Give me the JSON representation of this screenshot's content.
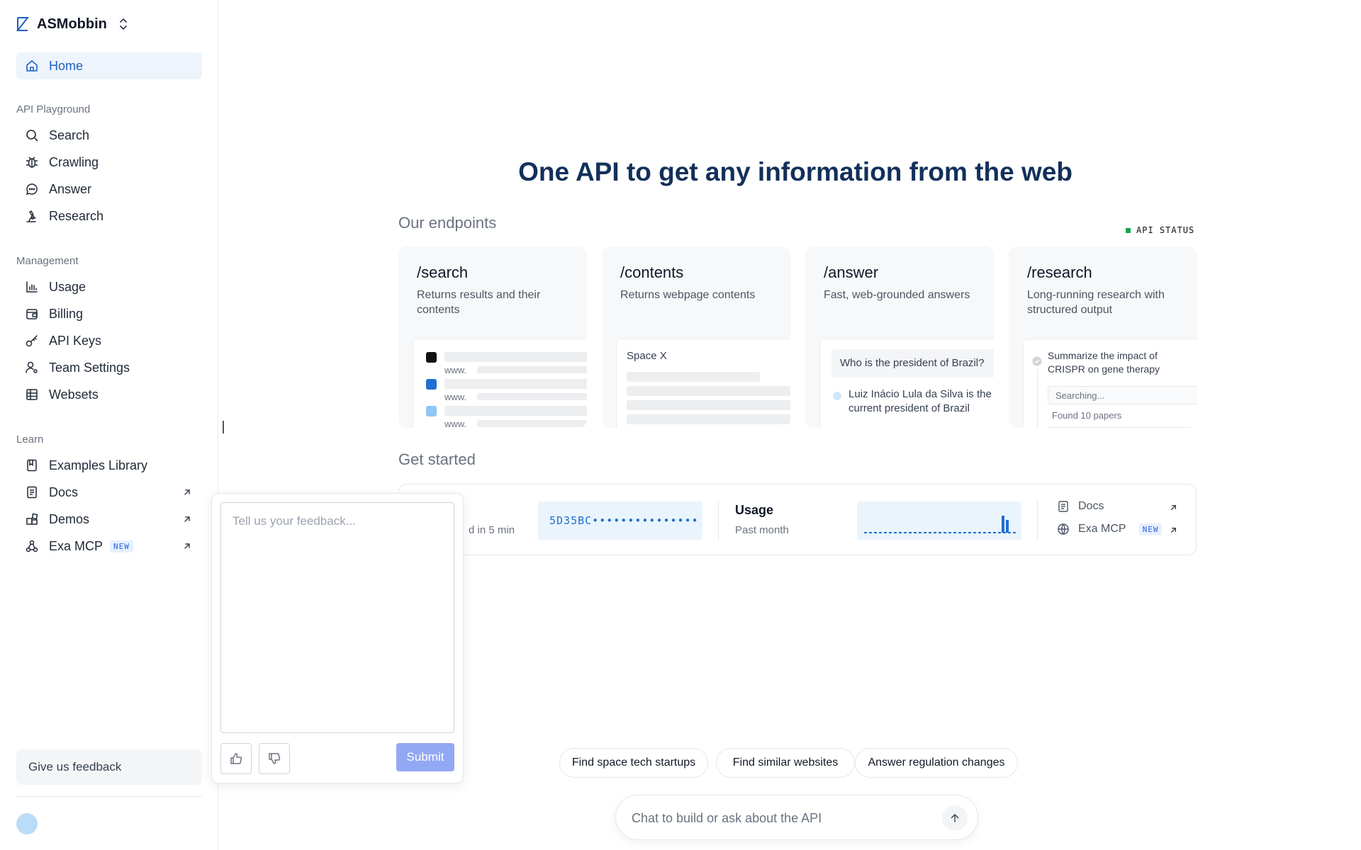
{
  "brand": {
    "name": "ASMobbin"
  },
  "sidebar": {
    "home": "Home",
    "sections": {
      "playground": "API Playground",
      "management": "Management",
      "learn": "Learn"
    },
    "playground_items": [
      "Search",
      "Crawling",
      "Answer",
      "Research"
    ],
    "management_items": [
      "Usage",
      "Billing",
      "API Keys",
      "Team Settings",
      "Websets"
    ],
    "learn_items": [
      "Examples Library",
      "Docs",
      "Demos",
      "Exa MCP"
    ],
    "new_badge": "NEW",
    "feedback_button": "Give us feedback"
  },
  "feedback": {
    "placeholder": "Tell us your feedback...",
    "submit": "Submit"
  },
  "main": {
    "hero": "One API to get any information from the web",
    "endpoints_heading": "Our endpoints",
    "api_status": "API STATUS",
    "cards": [
      {
        "title": "/search",
        "desc": "Returns results and their contents",
        "preview_label": "www."
      },
      {
        "title": "/contents",
        "desc": "Returns webpage contents",
        "preview_label": "Space X"
      },
      {
        "title": "/answer",
        "desc": "Fast, web-grounded answers",
        "question": "Who is the president of Brazil?",
        "reply": "Luiz Inácio Lula da Silva is the current president of Brazil"
      },
      {
        "title": "/research",
        "desc": "Long-running research with structured output",
        "task": "Summarize the impact of CRISPR on gene therapy",
        "status": "Searching...",
        "found": "Found 10 papers"
      }
    ],
    "get_started_heading": "Get started",
    "get_started": {
      "partial_text": "d in 5 min",
      "api_key": "5D35BC•••••••••••••••",
      "usage_title": "Usage",
      "usage_sub": "Past month",
      "docs_label": "Docs",
      "mcp_label": "Exa MCP",
      "new_badge": "NEW"
    },
    "chips": [
      "Find space tech startups",
      "Find similar websites",
      "Answer regulation changes"
    ],
    "chat_placeholder": "Chat to build or ask about the API"
  },
  "colors": {
    "accent": "#1d5fbf",
    "active_bg": "#eef4fb",
    "submit": "#93a8f4",
    "status_green": "#16a34a"
  }
}
